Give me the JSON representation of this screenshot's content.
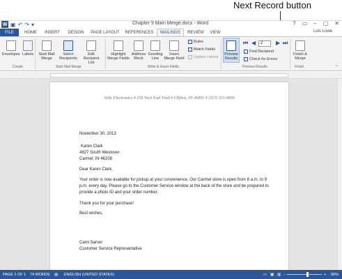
{
  "callout": {
    "label": "Next Record button"
  },
  "titlebar": {
    "qat_icons": [
      "word-logo",
      "save-icon",
      "undo-icon",
      "redo-icon",
      "customize-icon"
    ],
    "logo_letter": "W",
    "title": "Chapter 9 Main Merge.docx - Word",
    "window_buttons": [
      "?",
      "▭",
      "–",
      "▢",
      "✕"
    ]
  },
  "tabs": [
    "FILE",
    "HOME",
    "INSERT",
    "DESIGN",
    "PAGE LAYOUT",
    "REFERENCES",
    "MAILINGS",
    "REVIEW",
    "VIEW"
  ],
  "active_tab": "MAILINGS",
  "user": "Lois Lowe",
  "ribbon": {
    "create": {
      "envelopes": "Envelopes",
      "labels": "Labels",
      "group": "Create"
    },
    "start": {
      "start_mail_merge": "Start Mail Merge",
      "select_recipients": "Select Recipients",
      "edit_recipient_list": "Edit Recipient List",
      "group": "Start Mail Merge"
    },
    "write": {
      "highlight": "Highlight Merge Fields",
      "address": "Address Block",
      "greeting": "Greeting Line",
      "insert": "Insert Merge Field",
      "rules": "Rules",
      "match": "Match Fields",
      "update": "Update Labels",
      "group": "Write & Insert Fields"
    },
    "preview": {
      "preview_results": "Preview Results",
      "record": "2",
      "find": "Find Recipient",
      "check": "Check for Errors",
      "group": "Preview Results"
    },
    "finish": {
      "finish_merge": "Finish & Merge",
      "group": "Finish"
    }
  },
  "document": {
    "letterhead": "Seltz Electronics  #  258 West End Trail  #  Clifton, IN  46891  #  (317) 555-9899",
    "date": "November 30, 2013",
    "address": [
      "Karen Clark",
      "4827 South Westover",
      "Carmel, IN 46208"
    ],
    "salutation": "Dear Karen Clark,",
    "paragraph": [
      "Your order is now available for pickup at your convenience. Our Carmel store is open from 8 a.m. to 9",
      "p.m. every day.  Please go to the Customer Service window at the back of the store and be prepared to",
      "provide a photo ID and your order number."
    ],
    "thanks": "Thank you for your purchase!",
    "closing": "Best wishes,",
    "signer": "Cami Sarver",
    "signer_title": "Customer Service Representative"
  },
  "status": {
    "page": "PAGE 1 OF 1",
    "words": "74 WORDS",
    "language": "ENGLISH (UNITED STATES)",
    "zoom": "90%"
  },
  "colors": {
    "word_blue": "#2b579a",
    "ribbon_bg": "#f3f3f3",
    "canvas": "#e4e4e4"
  }
}
